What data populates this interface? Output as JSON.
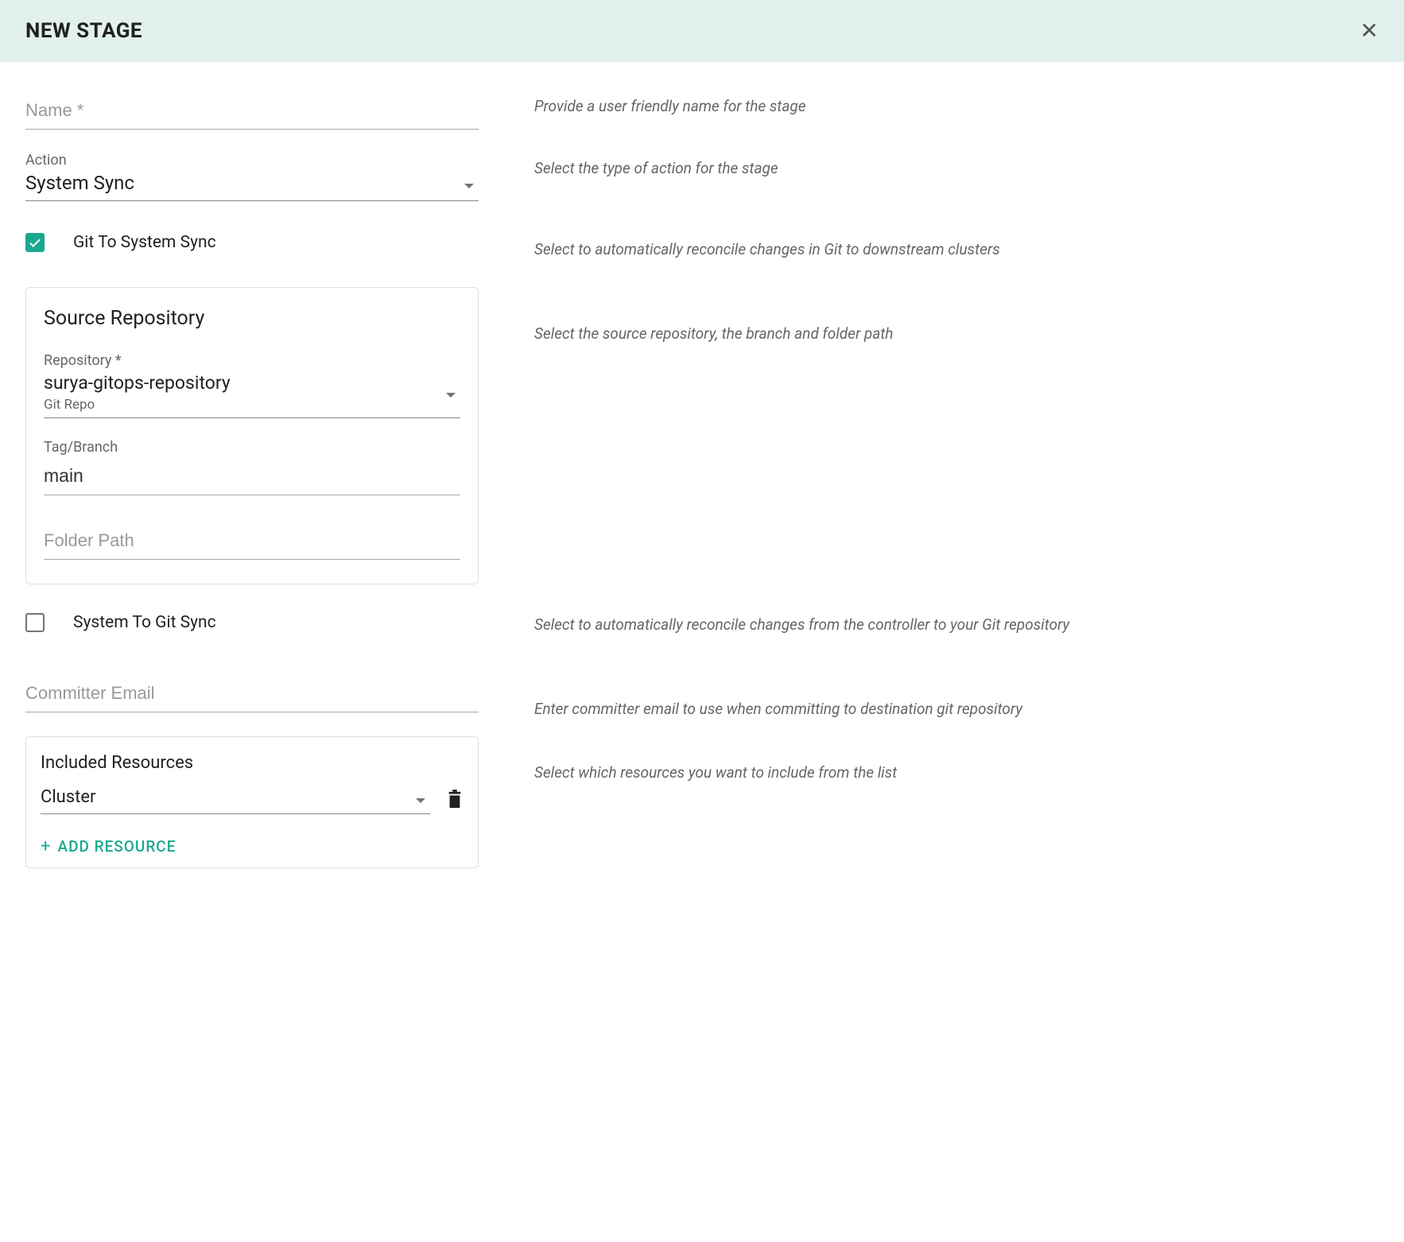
{
  "header": {
    "title": "NEW STAGE"
  },
  "fields": {
    "name": {
      "placeholder": "Name *",
      "value": "",
      "help": "Provide a user friendly name for the stage"
    },
    "action": {
      "label": "Action",
      "value": "System Sync",
      "help": "Select the type of action for the stage"
    },
    "git_to_system": {
      "label": "Git To System Sync",
      "checked": true,
      "help": "Select to automatically reconcile changes in Git to downstream clusters"
    },
    "source_repo": {
      "title": "Source Repository",
      "help": "Select the source repository, the branch and folder path",
      "repository": {
        "label": "Repository *",
        "value": "surya-gitops-repository",
        "sub": "Git Repo"
      },
      "tag_branch": {
        "label": "Tag/Branch",
        "value": "main"
      },
      "folder_path": {
        "placeholder": "Folder Path",
        "value": ""
      }
    },
    "system_to_git": {
      "label": "System To Git Sync",
      "checked": false,
      "help": "Select to automatically reconcile changes from the controller to your Git repository"
    },
    "committer_email": {
      "placeholder": "Committer Email",
      "value": "",
      "help": "Enter committer email to use when committing to destination git repository"
    },
    "included_resources": {
      "title": "Included Resources",
      "value": "Cluster",
      "add_button": "ADD  RESOURCE",
      "help": "Select which resources you want to include from the list"
    }
  }
}
